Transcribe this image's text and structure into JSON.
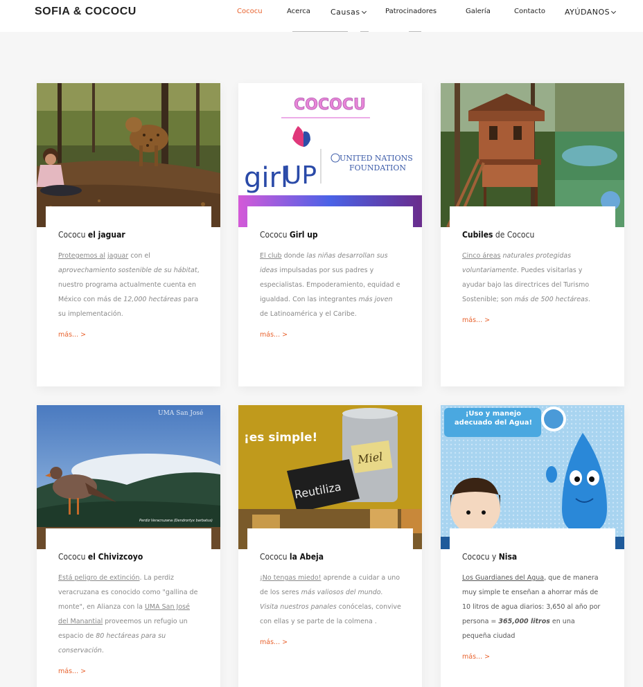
{
  "header": {
    "brand": "SOFIA & COCOCU",
    "nav": [
      "Cococu",
      "Acerca",
      "Causas",
      "Patrocinadores",
      "Galería",
      "Contacto",
      "AYÚDANOS"
    ]
  },
  "colors": {
    "accent": "#e8612c",
    "text": "#888888",
    "title": "#333333"
  },
  "cards": [
    {
      "title_pre": "Cococu ",
      "title_bold": "el jaguar",
      "title_post": "",
      "text": [
        {
          "t": "Protegemos al",
          "s": "u"
        },
        {
          "t": " ",
          "s": ""
        },
        {
          "t": "jaguar",
          "s": "u"
        },
        {
          "t": " con el ",
          "s": ""
        },
        {
          "t": "aprovechamiento sostenible de su hábitat",
          "s": "i"
        },
        {
          "t": ", nuestro programa actualmente cuenta en México con más de ",
          "s": ""
        },
        {
          "t": "12,000 hectáreas",
          "s": "i"
        },
        {
          "t": " para su implementación.",
          "s": ""
        }
      ],
      "more": "más...",
      "image_label": "girl-and-jaguar-photo"
    },
    {
      "title_pre": "Cococu ",
      "title_bold": "Girl up",
      "title_post": "",
      "text": [
        {
          "t": "El club",
          "s": "u"
        },
        {
          "t": " donde ",
          "s": ""
        },
        {
          "t": "las niñas desarrollan sus ideas",
          "s": "i"
        },
        {
          "t": " impulsadas por sus padres y especialistas. Empoderamiento, equidad e igualdad. Con las integrantes ",
          "s": ""
        },
        {
          "t": "más joven",
          "s": "i"
        },
        {
          "t": " de Latinoamérica y el Caribe.",
          "s": ""
        }
      ],
      "more": "más...",
      "image_label": "cococu-girl-up-logo",
      "logo": {
        "cococu": "COCOCU",
        "girl": "girl",
        "up": "UP",
        "un1": "UNITED NATIONS",
        "un2": "FOUNDATION"
      }
    },
    {
      "title_pre": "",
      "title_bold": "Cubiles",
      "title_post": " de Cococu",
      "text": [
        {
          "t": "Cinco áreas",
          "s": "u"
        },
        {
          "t": " ",
          "s": ""
        },
        {
          "t": "naturales protegidas voluntariamente",
          "s": "i"
        },
        {
          "t": ". Puedes visitarlas y ayudar bajo las directrices del Turismo Sostenible; son ",
          "s": ""
        },
        {
          "t": "más de 500 hectáreas",
          "s": "i"
        },
        {
          "t": ".",
          "s": ""
        }
      ],
      "more": "más...",
      "image_label": "treehouse-cabin-photo"
    },
    {
      "title_pre": "Cococu ",
      "title_bold": "el Chivizcoyo",
      "title_post": "",
      "text": [
        {
          "t": "Está peligro de extinción",
          "s": "u"
        },
        {
          "t": ". La perdiz veracruzana es conocido como \"gallina de monte\", en Alianza con la ",
          "s": ""
        },
        {
          "t": "UMA San José del Manantial",
          "s": "u"
        },
        {
          "t": " proveemos un refugio un espacio de ",
          "s": ""
        },
        {
          "t": "80 hectáreas para su conservación",
          "s": "i"
        },
        {
          "t": ".",
          "s": ""
        }
      ],
      "more": "más...",
      "image_label": "partridge-mountain-photo",
      "img_caption": "Perdiz Veracruzana (Dendrortyx barbatus)",
      "img_top_text": "UMA San José"
    },
    {
      "title_pre": "Cococu ",
      "title_bold": "la Abeja",
      "title_post": "",
      "text": [
        {
          "t": "¡No tengas miedo!",
          "s": "u"
        },
        {
          "t": " aprende a cuidar a uno de los seres ",
          "s": ""
        },
        {
          "t": "más valiosos del mundo. Visita nuestros panales",
          "s": "i"
        },
        {
          "t": " conócelas, convive con ellas y se parte de la colmena .",
          "s": ""
        }
      ],
      "more": "más...",
      "image_label": "honey-jar-photo",
      "img_text": "¡es simple!",
      "img_sign": "Reutiliza",
      "img_jar": "Miel"
    },
    {
      "title_pre": "Cococu y ",
      "title_bold": "Nisa",
      "title_post": "",
      "text": [
        {
          "t": "Los Guardianes del Agua",
          "s": "du"
        },
        {
          "t": ", que de manera muy simple te enseñan a ahorrar más de 10 litros de agua diarios: 3,650 al año por persona = ",
          "s": "d"
        },
        {
          "t": "365,000 litros",
          "s": "di"
        },
        {
          "t": " en una pequeña ciudad",
          "s": "d"
        }
      ],
      "more": "más...",
      "image_label": "water-drop-cartoon",
      "img_text": "¡Uso y manejo adecuado del Agua!"
    }
  ]
}
